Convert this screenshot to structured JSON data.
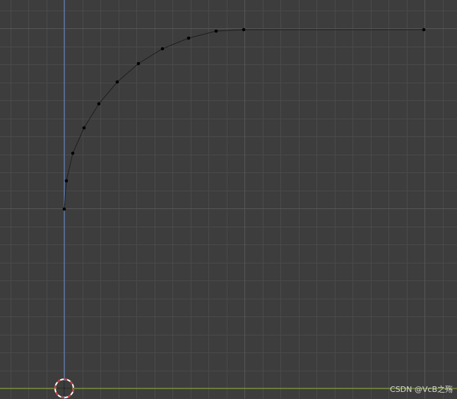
{
  "viewport": {
    "background_color": "#3d3d3d",
    "minor_grid_color": "#4a4a4a",
    "major_grid_color": "#565656",
    "z_axis_color": "#5c7fb8",
    "x_axis_color": "#7c9a34",
    "curve_color": "#1e1e1e",
    "vertex_color": "#000000",
    "cursor_ring_colors": [
      "#ffffff",
      "#d63a3a"
    ],
    "cursor_icon": "3d-cursor-icon",
    "vertex_icon": "vertex-dot-icon"
  },
  "watermark": "CSDN @VcB之殇"
}
